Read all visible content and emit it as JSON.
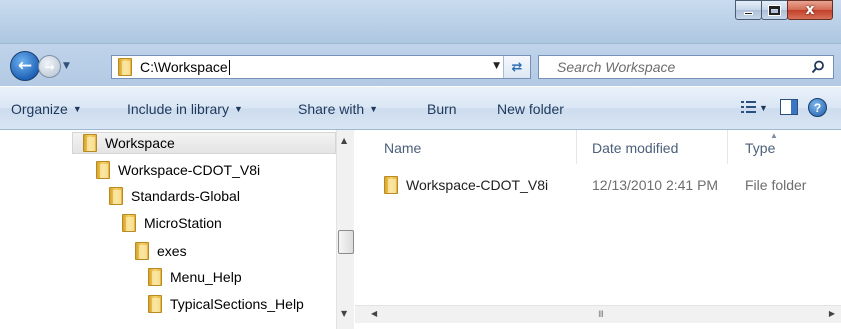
{
  "window": {
    "controls": {
      "minimize_icon": "minimize-icon",
      "maximize_icon": "maximize-icon",
      "close_label": "x"
    }
  },
  "address_bar": {
    "path": "C:\\Workspace",
    "search_placeholder": "Search Workspace"
  },
  "command_bar": {
    "organize": "Organize",
    "include_in_library": "Include in library",
    "share_with": "Share with",
    "burn": "Burn",
    "new_folder": "New folder",
    "help": "?"
  },
  "nav_tree": {
    "items": [
      {
        "label": "Workspace",
        "selected": true
      },
      {
        "label": "Workspace-CDOT_V8i"
      },
      {
        "label": "Standards-Global"
      },
      {
        "label": "MicroStation"
      },
      {
        "label": "exes"
      },
      {
        "label": "Menu_Help"
      },
      {
        "label": "TypicalSections_Help"
      }
    ]
  },
  "content": {
    "columns": {
      "name": "Name",
      "date": "Date modified",
      "type": "Type"
    },
    "rows": [
      {
        "name": "Workspace-CDOT_V8i",
        "date": "12/13/2010 2:41 PM",
        "type": "File folder"
      }
    ],
    "hscroll_grip": "III"
  },
  "colors": {
    "folder": "#f0c24a",
    "accent": "#1f63b8",
    "command_text": "#1e395b"
  }
}
